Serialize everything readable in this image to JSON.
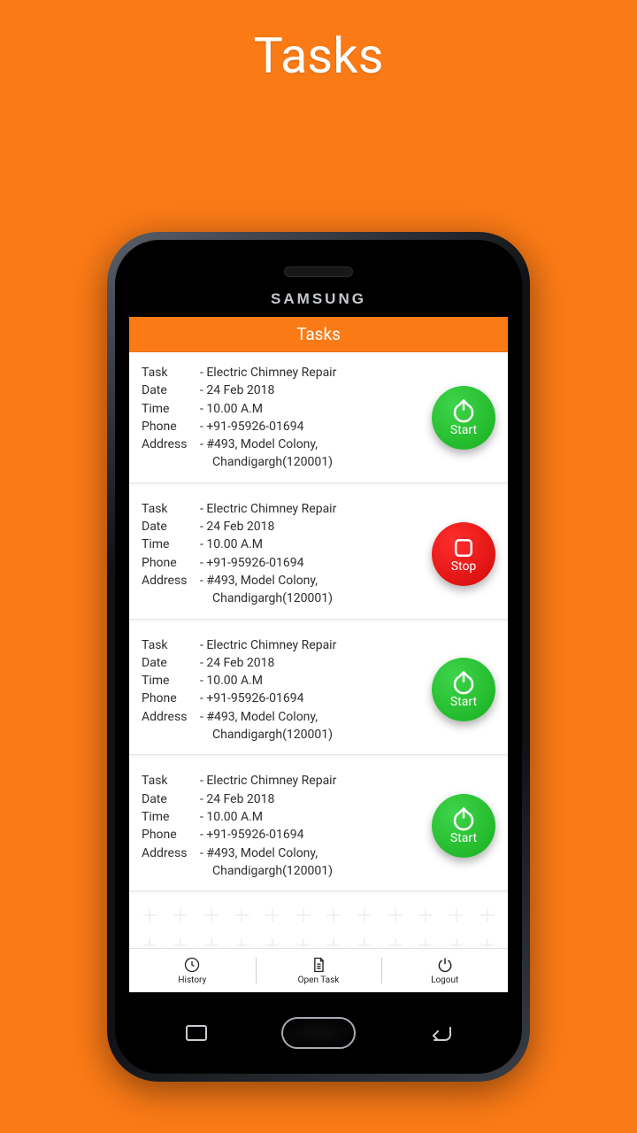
{
  "page_title": "Tasks",
  "brand": "SAMSUNG",
  "app_header": "Tasks",
  "labels": {
    "task": "Task",
    "date": "Date",
    "time": "Time",
    "phone": "Phone",
    "address": "Address"
  },
  "actions": {
    "start": "Start",
    "stop": "Stop"
  },
  "tasks": [
    {
      "task": "Electric Chimney Repair",
      "date": "24 Feb 2018",
      "time": "10.00 A.M",
      "phone": "+91-95926-01694",
      "address1": "#493, Model Colony,",
      "address2": "Chandigargh(120001)",
      "action": "start"
    },
    {
      "task": "Electric Chimney Repair",
      "date": "24 Feb 2018",
      "time": "10.00 A.M",
      "phone": "+91-95926-01694",
      "address1": "#493, Model Colony,",
      "address2": "Chandigargh(120001)",
      "action": "stop"
    },
    {
      "task": "Electric Chimney Repair",
      "date": "24 Feb 2018",
      "time": "10.00 A.M",
      "phone": "+91-95926-01694",
      "address1": "#493, Model Colony,",
      "address2": "Chandigargh(120001)",
      "action": "start"
    },
    {
      "task": "Electric Chimney Repair",
      "date": "24 Feb 2018",
      "time": "10.00 A.M",
      "phone": "+91-95926-01694",
      "address1": "#493, Model Colony,",
      "address2": "Chandigargh(120001)",
      "action": "start"
    }
  ],
  "nav": {
    "history": "History",
    "open_task": "Open Task",
    "logout": "Logout"
  }
}
